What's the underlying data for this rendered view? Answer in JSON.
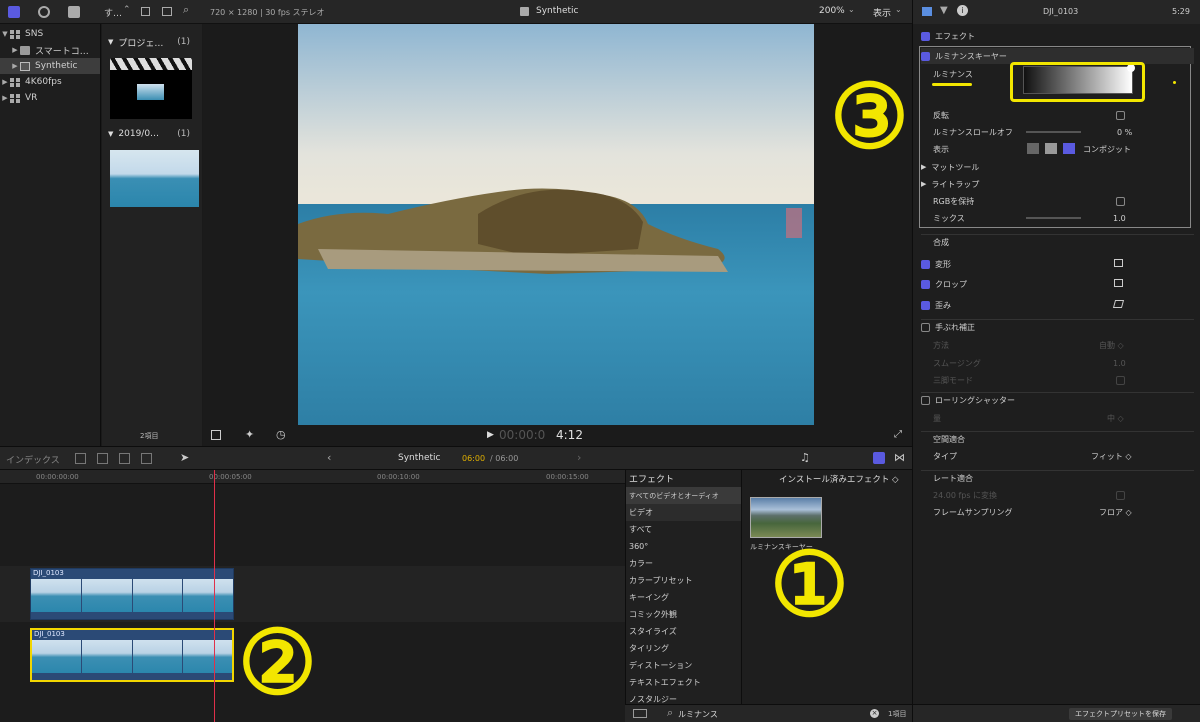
{
  "topbar": {
    "libs_label": "す…",
    "viewer_info": "720 × 1280 | 30 fps ステレオ",
    "project": "Synthetic",
    "zoom": "200%",
    "display": "表示",
    "clip_name": "DJI_0103",
    "duration": "5:29"
  },
  "library": {
    "items": [
      {
        "label": "SNS",
        "type": "library",
        "expanded": true
      },
      {
        "label": "スマートコ…",
        "type": "folder"
      },
      {
        "label": "Synthetic",
        "type": "project",
        "selected": true
      },
      {
        "label": "4K60fps",
        "type": "event"
      },
      {
        "label": "VR",
        "type": "event"
      }
    ]
  },
  "clips": {
    "groups": [
      {
        "label": "プロジェ…",
        "count": "(1)"
      },
      {
        "label": "2019/0…",
        "count": "(1)"
      }
    ],
    "footer": "2項目"
  },
  "viewer": {
    "timecode_dim": "00:00:0",
    "timecode": "4:12"
  },
  "inspector": {
    "effects_header": "エフェクト",
    "keyer_title": "ルミナンスキーヤー",
    "luminance_label": "ルミナンス",
    "invert_label": "反転",
    "rolloff_label": "ルミナンスロールオフ",
    "rolloff_value": "0 %",
    "view_label": "表示",
    "view_value": "コンポジット",
    "matte_tools": "マットツール",
    "light_wrap": "ライトラップ",
    "rgb_label": "RGBを保持",
    "mix_label": "ミックス",
    "mix_value": "1.0",
    "composite": "合成",
    "transform": "変形",
    "crop": "クロップ",
    "distort": "歪み",
    "stabilize": "手ぶれ補正",
    "stab_method": "方法",
    "stab_method_value": "自動 ◇",
    "stab_smooth": "スムージング",
    "stab_smooth_value": "1.0",
    "stab_tripod": "三脚モード",
    "rolling": "ローリングシャッター",
    "rolling_amount": "量",
    "rolling_amount_value": "中 ◇",
    "spatial": "空間適合",
    "type_label": "タイプ",
    "type_value": "フィット ◇",
    "rate": "レート適合",
    "rate_frame": "フレームサンプリング",
    "rate_frame_value": "フロア ◇",
    "rate_check": "24.00 fps に変換",
    "save_preset": "エフェクトプリセットを保存"
  },
  "timeline_bar": {
    "index": "インデックス",
    "project": "Synthetic",
    "time_current": "06:00",
    "time_total": "/ 06:00"
  },
  "ruler": [
    "00:00:00:00",
    "00:00:05:00",
    "00:00:10:00",
    "00:00:15:00"
  ],
  "tracks": [
    {
      "name": "DJI_0103"
    },
    {
      "name": "DJI_0103"
    }
  ],
  "effects": {
    "header": "エフェクト",
    "installed": "インストール済みエフェクト ◇",
    "categories": [
      "すべてのビデオとオーディオ",
      "ビデオ",
      "すべて",
      "360°",
      "カラー",
      "カラープリセット",
      "キーイング",
      "コミック外観",
      "スタイライズ",
      "タイリング",
      "ディストーション",
      "テキストエフェクト",
      "ノスタルジー"
    ],
    "item": "ルミナンスキーヤー",
    "search": "ルミナンス",
    "count": "1項目"
  },
  "annotations": [
    "①",
    "②",
    "③"
  ]
}
